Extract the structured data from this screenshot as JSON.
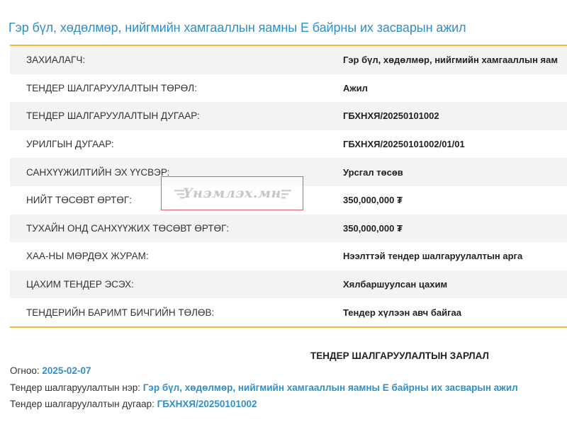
{
  "page": {
    "title": "Гэр бүл, хөдөлмөр, нийгмийн хамгааллын яамны Е байрны их засварын ажил"
  },
  "details": [
    {
      "label": "ЗАХИАЛАГЧ:",
      "value": "Гэр бүл, хөдөлмөр, нийгмийн хамгааллын яам"
    },
    {
      "label": "ТЕНДЕР ШАЛГАРУУЛАЛТЫН ТӨРӨЛ:",
      "value": "Ажил"
    },
    {
      "label": "ТЕНДЕР ШАЛГАРУУЛАЛТЫН ДУГААР:",
      "value": "ГБХНХЯ/20250101002"
    },
    {
      "label": "УРИЛГЫН ДУГААР:",
      "value": "ГБХНХЯ/20250101002/01/01"
    },
    {
      "label": "САНХҮҮЖИЛТИЙН ЭХ ҮҮСВЭР:",
      "value": "Урсгал төсөв"
    },
    {
      "label": "НИЙТ ТӨСӨВТ ӨРТӨГ:",
      "value": "350,000,000 ₮"
    },
    {
      "label": "ТУХАЙН ОНД САНХҮҮЖИХ ТӨСӨВТ ӨРТӨГ:",
      "value": "350,000,000 ₮"
    },
    {
      "label": "ХАА-НЫ МӨРДӨХ ЖУРАМ:",
      "value": "Нээлттэй тендер шалгаруулалтын арга"
    },
    {
      "label": "ЦАХИМ ТЕНДЕР ЭСЭХ:",
      "value": "Хялбаршуулсан цахим"
    },
    {
      "label": "ТЕНДЕРИЙН БАРИМТ БИЧГИЙН ТӨЛӨВ:",
      "value": "Тендер хүлээн авч байгаа"
    }
  ],
  "watermark": {
    "text": "Үнэмлэх.мн"
  },
  "announcement": {
    "heading": "ТЕНДЕР ШАЛГАРУУЛАЛТЫН ЗАРЛАЛ",
    "date_label": "Огноо: ",
    "date_value": "2025-02-07",
    "name_label": "Тендер шалгаруулалтын нэр: ",
    "name_value": "Гэр бүл, хөдөлмөр, нийгмийн хамгааллын яамны Е байрны их засварын ажил",
    "number_label": "Тендер шалгаруулалтын дугаар: ",
    "number_value": "ГБХНХЯ/20250101002"
  },
  "colors": {
    "accent": "#f0b63d",
    "link": "#2f8fc9",
    "row_shade": "#f3f3f3"
  }
}
